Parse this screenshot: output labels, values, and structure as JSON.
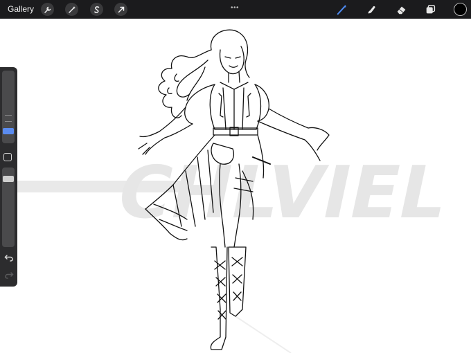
{
  "toolbar": {
    "gallery_label": "Gallery",
    "left_tools": [
      "wrench-icon",
      "magic-wand-icon",
      "selection-icon",
      "transform-arrow-icon"
    ],
    "more_label": "•••",
    "right_tools": [
      "brush-icon",
      "smudge-icon",
      "eraser-icon",
      "layers-icon"
    ],
    "active_tool": "brush-icon",
    "accent_color": "#4f8df5",
    "current_color": "#000000"
  },
  "sidebar": {
    "controls": [
      "brush-size-slider",
      "modify-button",
      "opacity-slider",
      "undo-icon",
      "redo-icon"
    ]
  },
  "canvas": {
    "watermark_text": "CHLVIEL"
  }
}
